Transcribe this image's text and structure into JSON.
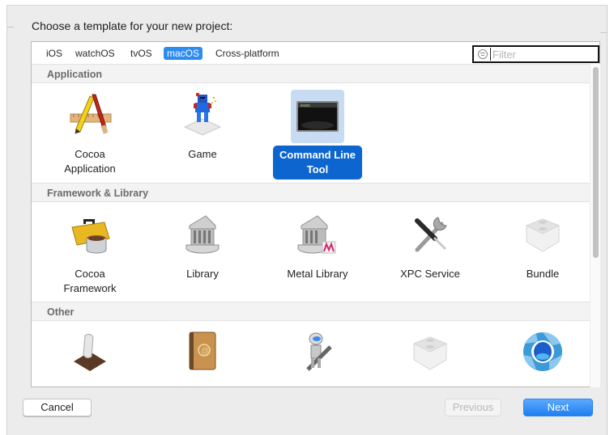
{
  "dialog": {
    "prompt": "Choose a template for your new project:"
  },
  "platform_tabs": [
    {
      "label": "iOS",
      "active": false
    },
    {
      "label": "watchOS",
      "active": false
    },
    {
      "label": "tvOS",
      "active": false
    },
    {
      "label": "macOS",
      "active": true
    },
    {
      "label": "Cross-platform",
      "active": false
    }
  ],
  "filter": {
    "placeholder": "Filter",
    "value": "",
    "icon": "filter-icon"
  },
  "sections": [
    {
      "title": "Application",
      "templates": [
        {
          "label": "Cocoa Application",
          "icon": "cocoa-app-icon",
          "selected": false
        },
        {
          "label": "Game",
          "icon": "game-icon",
          "selected": false
        },
        {
          "label": "Command Line Tool",
          "icon": "terminal-icon",
          "selected": true
        }
      ]
    },
    {
      "title": "Framework & Library",
      "templates": [
        {
          "label": "Cocoa Framework",
          "icon": "toolbox-icon",
          "selected": false
        },
        {
          "label": "Library",
          "icon": "library-icon",
          "selected": false
        },
        {
          "label": "Metal Library",
          "icon": "metal-library-icon",
          "selected": false
        },
        {
          "label": "XPC Service",
          "icon": "tools-icon",
          "selected": false
        },
        {
          "label": "Bundle",
          "icon": "bundle-icon",
          "selected": false
        }
      ]
    },
    {
      "title": "Other",
      "templates": [
        {
          "label": "",
          "icon": "applescript-icon",
          "selected": false
        },
        {
          "label": "",
          "icon": "address-book-icon",
          "selected": false
        },
        {
          "label": "",
          "icon": "automator-icon",
          "selected": false
        },
        {
          "label": "",
          "icon": "bundle-icon",
          "selected": false
        },
        {
          "label": "",
          "icon": "quartz-composer-icon",
          "selected": false
        }
      ]
    }
  ],
  "buttons": {
    "cancel": "Cancel",
    "previous": "Previous",
    "next": "Next",
    "previous_enabled": false
  },
  "colors": {
    "accent": "#2e8bf0",
    "selection": "#0d66d0",
    "selection_tint": "#c7dcf3"
  }
}
